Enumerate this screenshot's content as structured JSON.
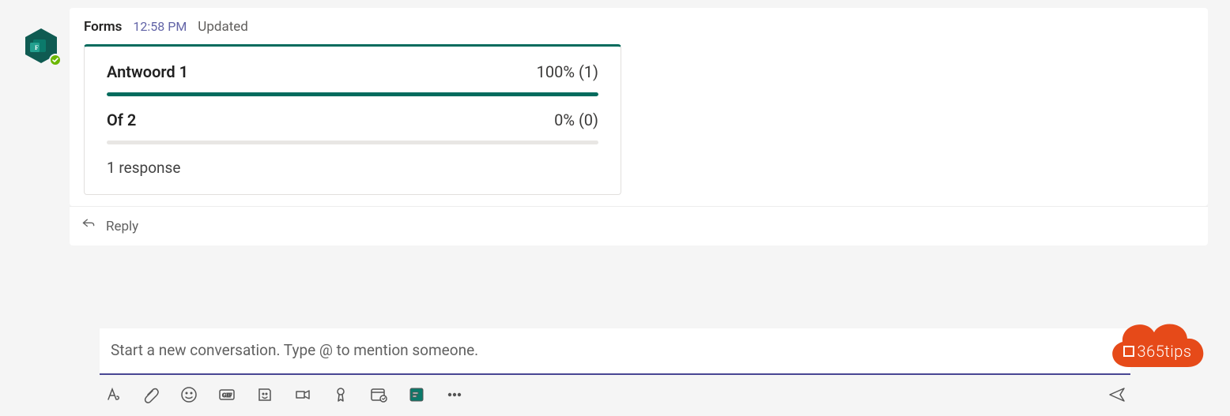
{
  "message": {
    "sender": "Forms",
    "time": "12:58 PM",
    "status": "Updated"
  },
  "poll": {
    "options": [
      {
        "label": "Antwoord 1",
        "pct_text": "100% (1)",
        "pct": 100
      },
      {
        "label": "Of 2",
        "pct_text": "0% (0)",
        "pct": 0
      }
    ],
    "summary": "1 response"
  },
  "reply": {
    "label": "Reply"
  },
  "compose": {
    "placeholder": "Start a new conversation. Type @ to mention someone."
  },
  "watermark": {
    "text": "365tips"
  },
  "colors": {
    "teams_accent": "#484693",
    "forms_green": "#036b5d",
    "watermark": "#e64a19"
  }
}
